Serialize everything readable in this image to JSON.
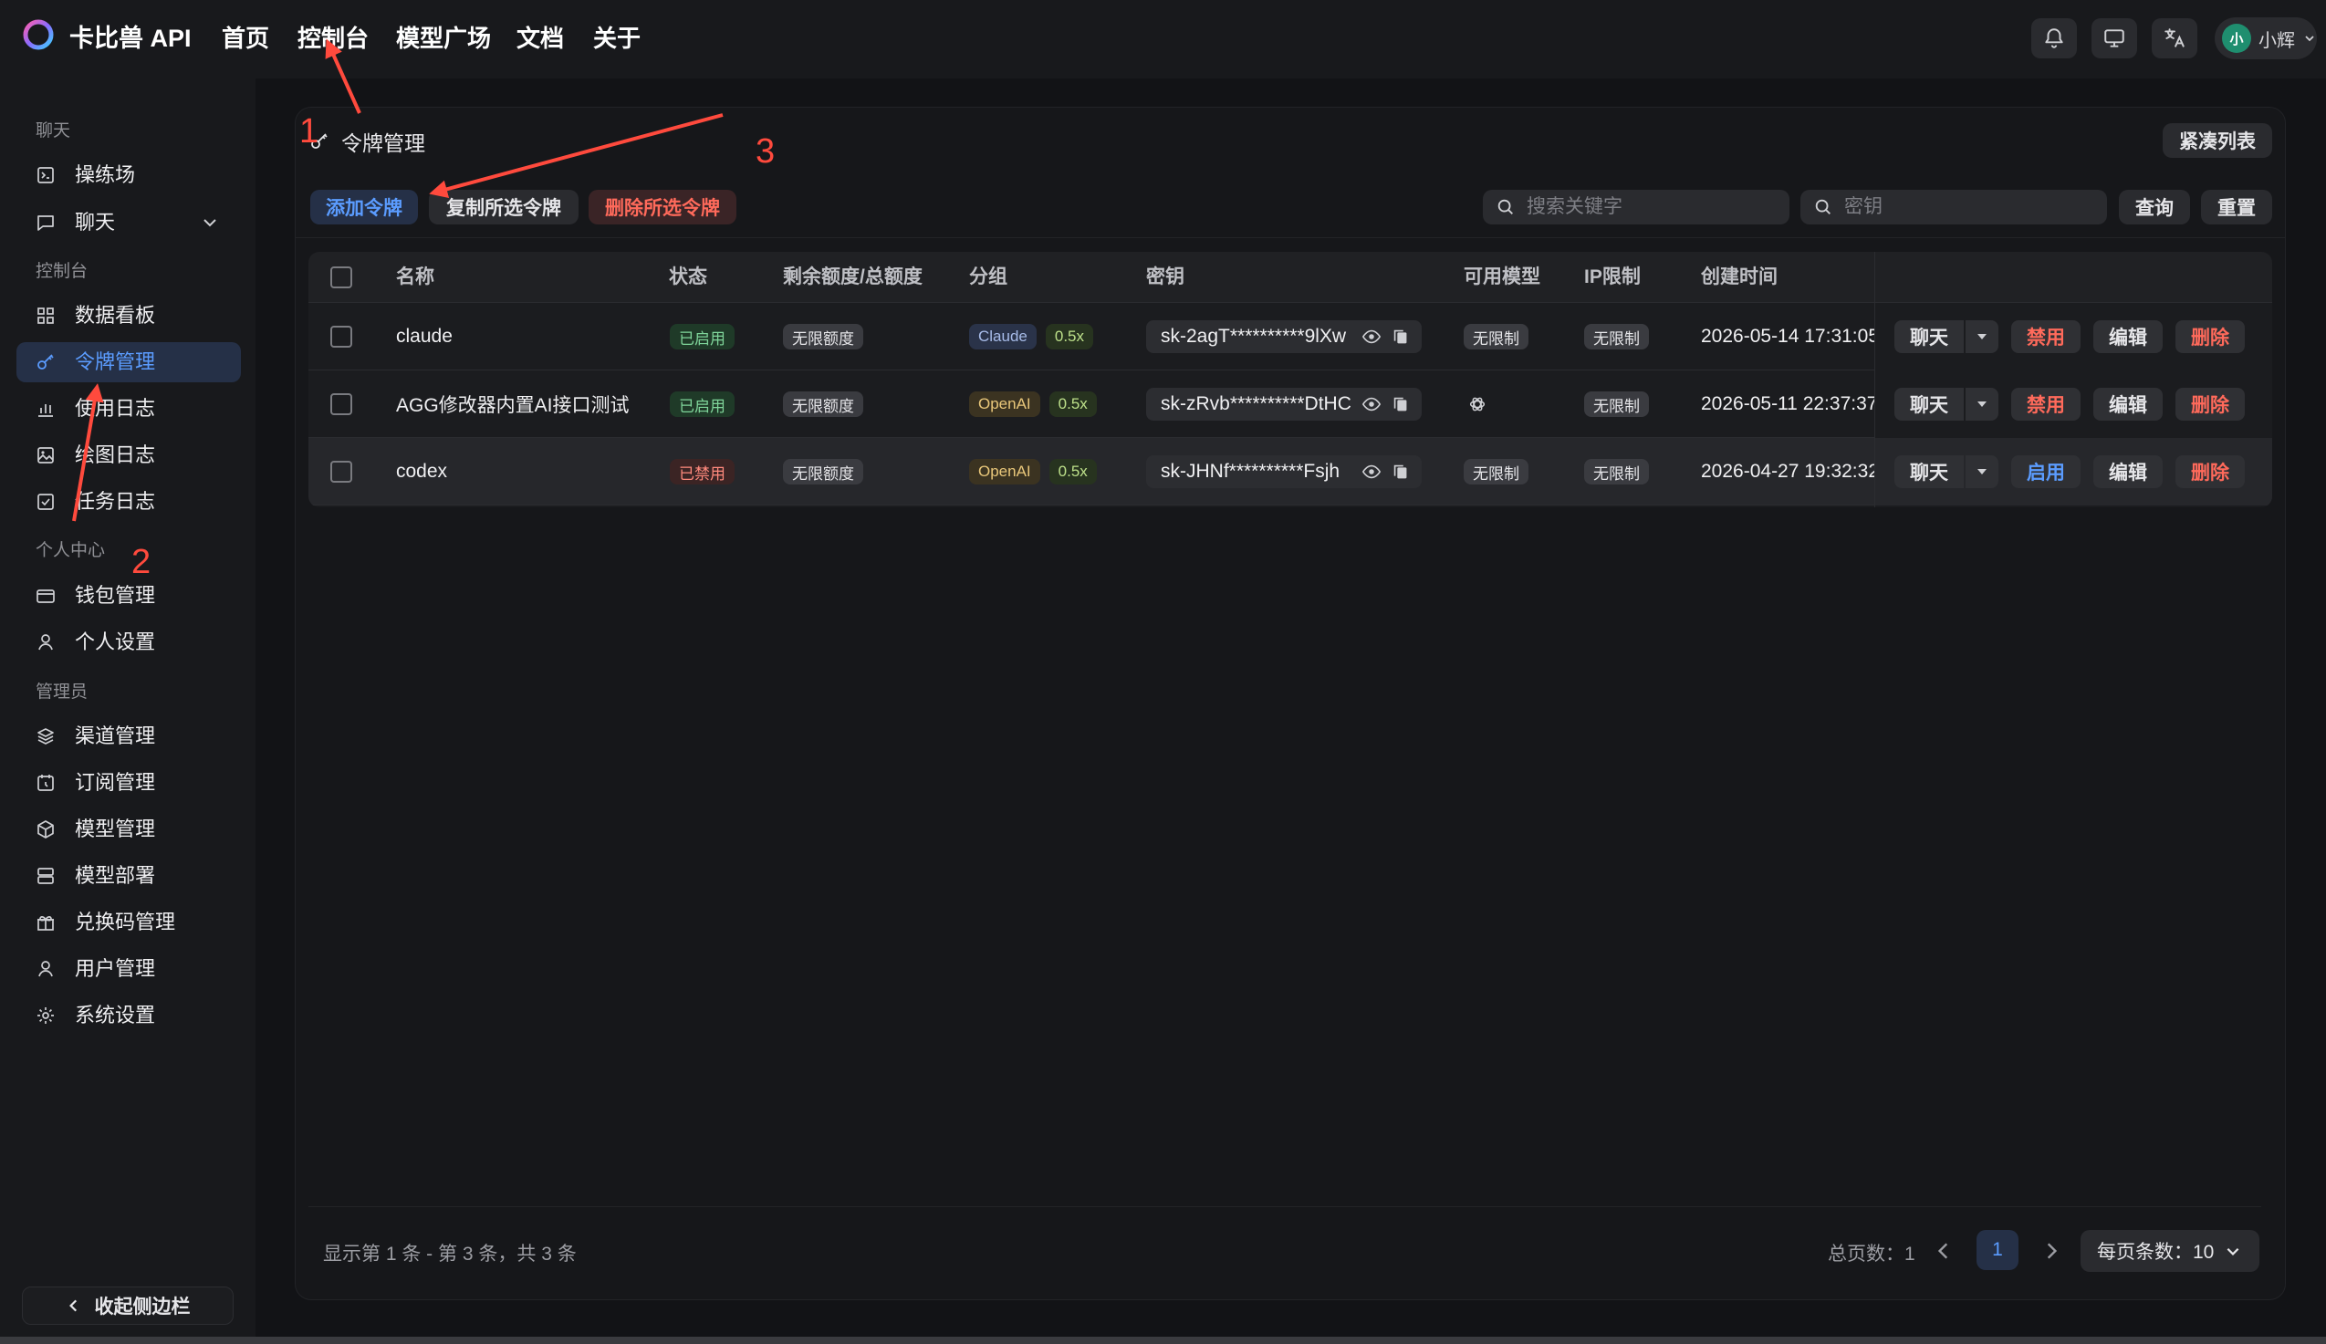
{
  "topbar": {
    "brand": "卡比兽 API",
    "nav": [
      "首页",
      "控制台",
      "模型广场",
      "文档",
      "关于"
    ],
    "user_initial": "小",
    "user_name": "小辉"
  },
  "sidebar": {
    "sections": {
      "chat": "聊天",
      "console": "控制台",
      "personal": "个人中心",
      "admin": "管理员"
    },
    "items": {
      "playground": "操练场",
      "chat": "聊天",
      "dashboard": "数据看板",
      "tokens": "令牌管理",
      "usage_log": "使用日志",
      "drawing_log": "绘图日志",
      "task_log": "任务日志",
      "wallet": "钱包管理",
      "settings": "个人设置",
      "channels": "渠道管理",
      "subscriptions": "订阅管理",
      "models": "模型管理",
      "deploy": "模型部署",
      "redeem": "兑换码管理",
      "users": "用户管理",
      "system": "系统设置"
    },
    "collapse": "收起侧边栏"
  },
  "page": {
    "title": "令牌管理",
    "compact": "紧凑列表",
    "add": "添加令牌",
    "copy": "复制所选令牌",
    "delete": "删除所选令牌",
    "search_placeholder": "搜索关键字",
    "key_placeholder": "密钥",
    "query": "查询",
    "reset": "重置"
  },
  "table": {
    "headers": [
      "名称",
      "状态",
      "剩余额度/总额度",
      "分组",
      "密钥",
      "可用模型",
      "IP限制",
      "创建时间"
    ],
    "rows": [
      {
        "name": "claude",
        "status": "已启用",
        "quota": "无限额度",
        "group": "Claude",
        "ratio": "0.5x",
        "key": "sk-2agT**********9lXw",
        "models": "无限制",
        "ip": "无限制",
        "created": "2026-05-14 17:31:05",
        "toggle": "禁用"
      },
      {
        "name": "AGG修改器内置AI接口测试",
        "status": "已启用",
        "quota": "无限额度",
        "group": "OpenAI",
        "ratio": "0.5x",
        "key": "sk-zRvb**********DtHC",
        "models": "",
        "ip": "无限制",
        "created": "2026-05-11 22:37:37",
        "toggle": "禁用"
      },
      {
        "name": "codex",
        "status": "已禁用",
        "quota": "无限额度",
        "group": "OpenAI",
        "ratio": "0.5x",
        "key": "sk-JHNf**********Fsjh",
        "models": "无限制",
        "ip": "无限制",
        "created": "2026-04-27 19:32:32",
        "toggle": "启用"
      }
    ],
    "actions": {
      "chat": "聊天",
      "edit": "编辑",
      "delete": "删除"
    }
  },
  "footer": {
    "info": "显示第 1 条 - 第 3 条，共 3 条",
    "total_pages": "总页数：1",
    "current_page": "1",
    "page_size": "每页条数：10"
  },
  "annotations": [
    "1",
    "2",
    "3"
  ],
  "colors": {
    "accent": "#5b9cff",
    "danger": "#ff6a5b",
    "annotation": "#ff4a3d"
  }
}
